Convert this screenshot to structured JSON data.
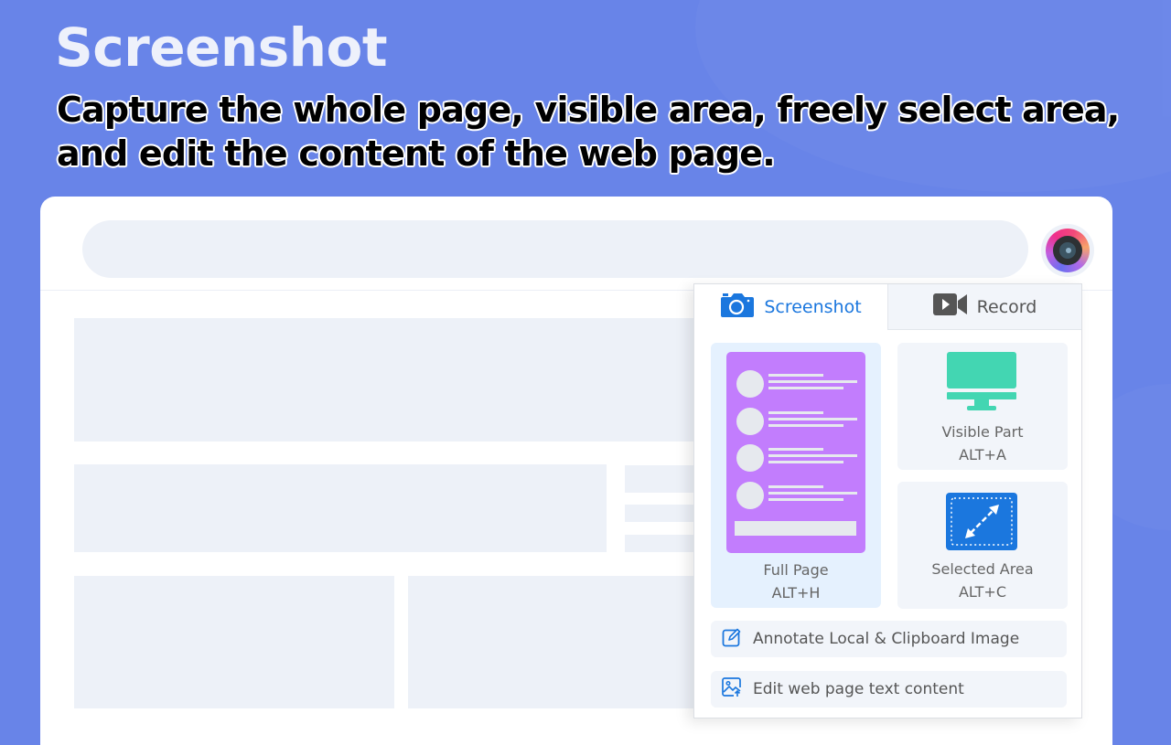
{
  "hero": {
    "title": "Screenshot",
    "subtitle": "Capture the whole page, visible area, freely select area, and edit the content of the web page."
  },
  "browser": {
    "address_bar_value": "",
    "extension_icon": "camera-lens-icon"
  },
  "popup": {
    "tabs": [
      {
        "label": "Screenshot",
        "icon": "camera-icon",
        "active": true
      },
      {
        "label": "Record",
        "icon": "video-camera-icon",
        "active": false
      }
    ],
    "capture_options": [
      {
        "label": "Full Page",
        "shortcut": "ALT+H",
        "icon": "full-page-icon",
        "highlighted": true
      },
      {
        "label": "Visible Part",
        "shortcut": "ALT+A",
        "icon": "monitor-icon",
        "highlighted": false
      },
      {
        "label": "Selected Area",
        "shortcut": "ALT+C",
        "icon": "selection-area-icon",
        "highlighted": false
      }
    ],
    "actions": [
      {
        "label": "Annotate Local & Clipboard Image",
        "icon": "edit-pencil-icon"
      },
      {
        "label": "Edit web page text content",
        "icon": "image-edit-icon"
      }
    ]
  },
  "colors": {
    "background": "#6884e8",
    "accent_blue": "#1b77de",
    "full_page_purple": "#c27dfd",
    "monitor_green": "#43d6b2",
    "card_bg": "#f2f5fa",
    "card_highlight_bg": "#e5f1fe"
  }
}
